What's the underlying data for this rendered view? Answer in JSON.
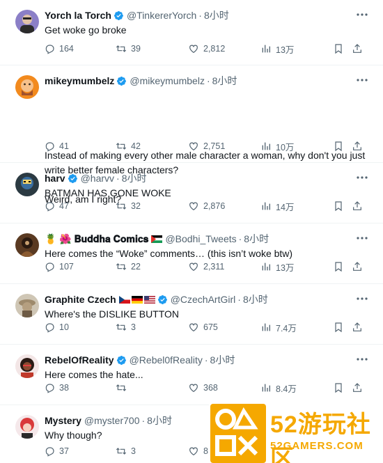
{
  "tweets": [
    {
      "name": "Yorch la Torch",
      "handle": "@TinkererYorch",
      "time": "8小时",
      "text": "Get woke go broke",
      "replies": "164",
      "retweets": "39",
      "likes": "2,812",
      "views": "13万",
      "avatar_color": "#8b7fc7"
    },
    {
      "name": "mikeymumbelz",
      "handle": "@mikeymumbelz",
      "time": "8小时",
      "text": "Instead of making every other male character a woman, why don't you just write better female characters?\n\nWeird, am I right?",
      "replies": "41",
      "retweets": "42",
      "likes": "2,751",
      "views": "10万",
      "avatar_color": "#f28a1e"
    },
    {
      "name": "harv",
      "handle": "@harvv",
      "time": "8小时",
      "text": "BATMAN HAS GONE WOKE",
      "replies": "47",
      "retweets": "32",
      "likes": "2,876",
      "views": "14万",
      "avatar_color": "#2b3a42"
    },
    {
      "name": "🍍 🌺 𝐁𝐮𝐝𝐝𝐡𝐚 𝐂𝐨𝐦𝐢𝐜𝐬",
      "handle": "@Bodhi_Tweets",
      "time": "8小时",
      "text": "Here comes the “Woke” comments… (this isn’t woke btw)",
      "replies": "107",
      "retweets": "22",
      "likes": "2,311",
      "views": "13万",
      "avatar_color": "#5a3a22"
    },
    {
      "name": "Graphite Czech",
      "handle": "@CzechArtGirl",
      "time": "8小时",
      "text": "Where's the DISLIKE BUTTON",
      "replies": "10",
      "retweets": "3",
      "likes": "675",
      "views": "7.4万",
      "avatar_color": "#9e8a6c"
    },
    {
      "name": "RebelOfReality",
      "handle": "@Rebel0fReality",
      "time": "8小时",
      "text": "Here comes the hate...",
      "replies": "38",
      "retweets": "",
      "likes": "368",
      "views": "8.4万",
      "avatar_color": "#6b3a2a"
    },
    {
      "name": "Mystery",
      "handle": "@myster700",
      "time": "8小时",
      "text": "Why though?",
      "replies": "37",
      "retweets": "3",
      "likes": "8",
      "views": "",
      "avatar_color": "#d93a3a"
    }
  ],
  "watermark": {
    "text_main": "52游玩社区",
    "text_sub": "52GAMERS.COM"
  },
  "colors": {
    "verified": "#1d9bf0",
    "muted": "#536471",
    "divider": "#eff3f4",
    "watermark": "#f5a800"
  },
  "icons": [
    "reply-icon",
    "retweet-icon",
    "like-icon",
    "views-icon",
    "bookmark-icon",
    "share-icon",
    "verified-badge-icon",
    "more-icon"
  ]
}
